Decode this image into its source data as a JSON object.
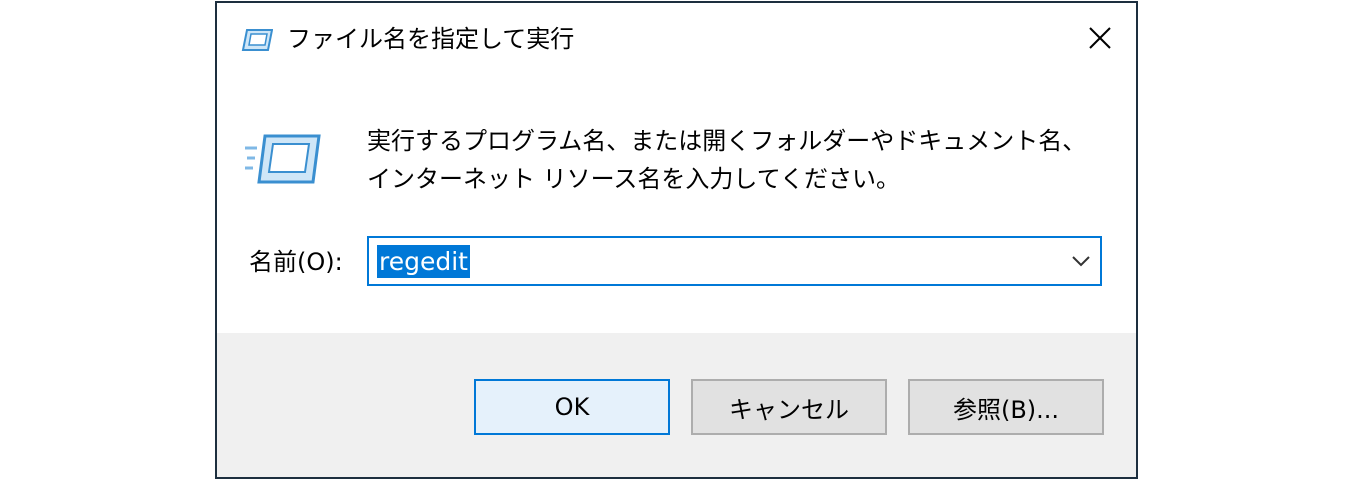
{
  "window": {
    "title": "ファイル名を指定して実行",
    "close_icon": "close-icon",
    "title_icon": "run-icon"
  },
  "content": {
    "icon": "run-icon",
    "description": "実行するプログラム名、または開くフォルダーやドキュメント名、インターネット リソース名を入力してください。",
    "name_label": "名前(O):",
    "name_value": "regedit",
    "dropdown_icon": "chevron-down-icon"
  },
  "buttons": {
    "ok": "OK",
    "cancel": "キャンセル",
    "browse": "参照(B)..."
  },
  "colors": {
    "accent": "#0078d7",
    "footer_bg": "#f0f0f0",
    "button_bg": "#e1e1e1",
    "ok_bg": "#e5f1fb"
  }
}
